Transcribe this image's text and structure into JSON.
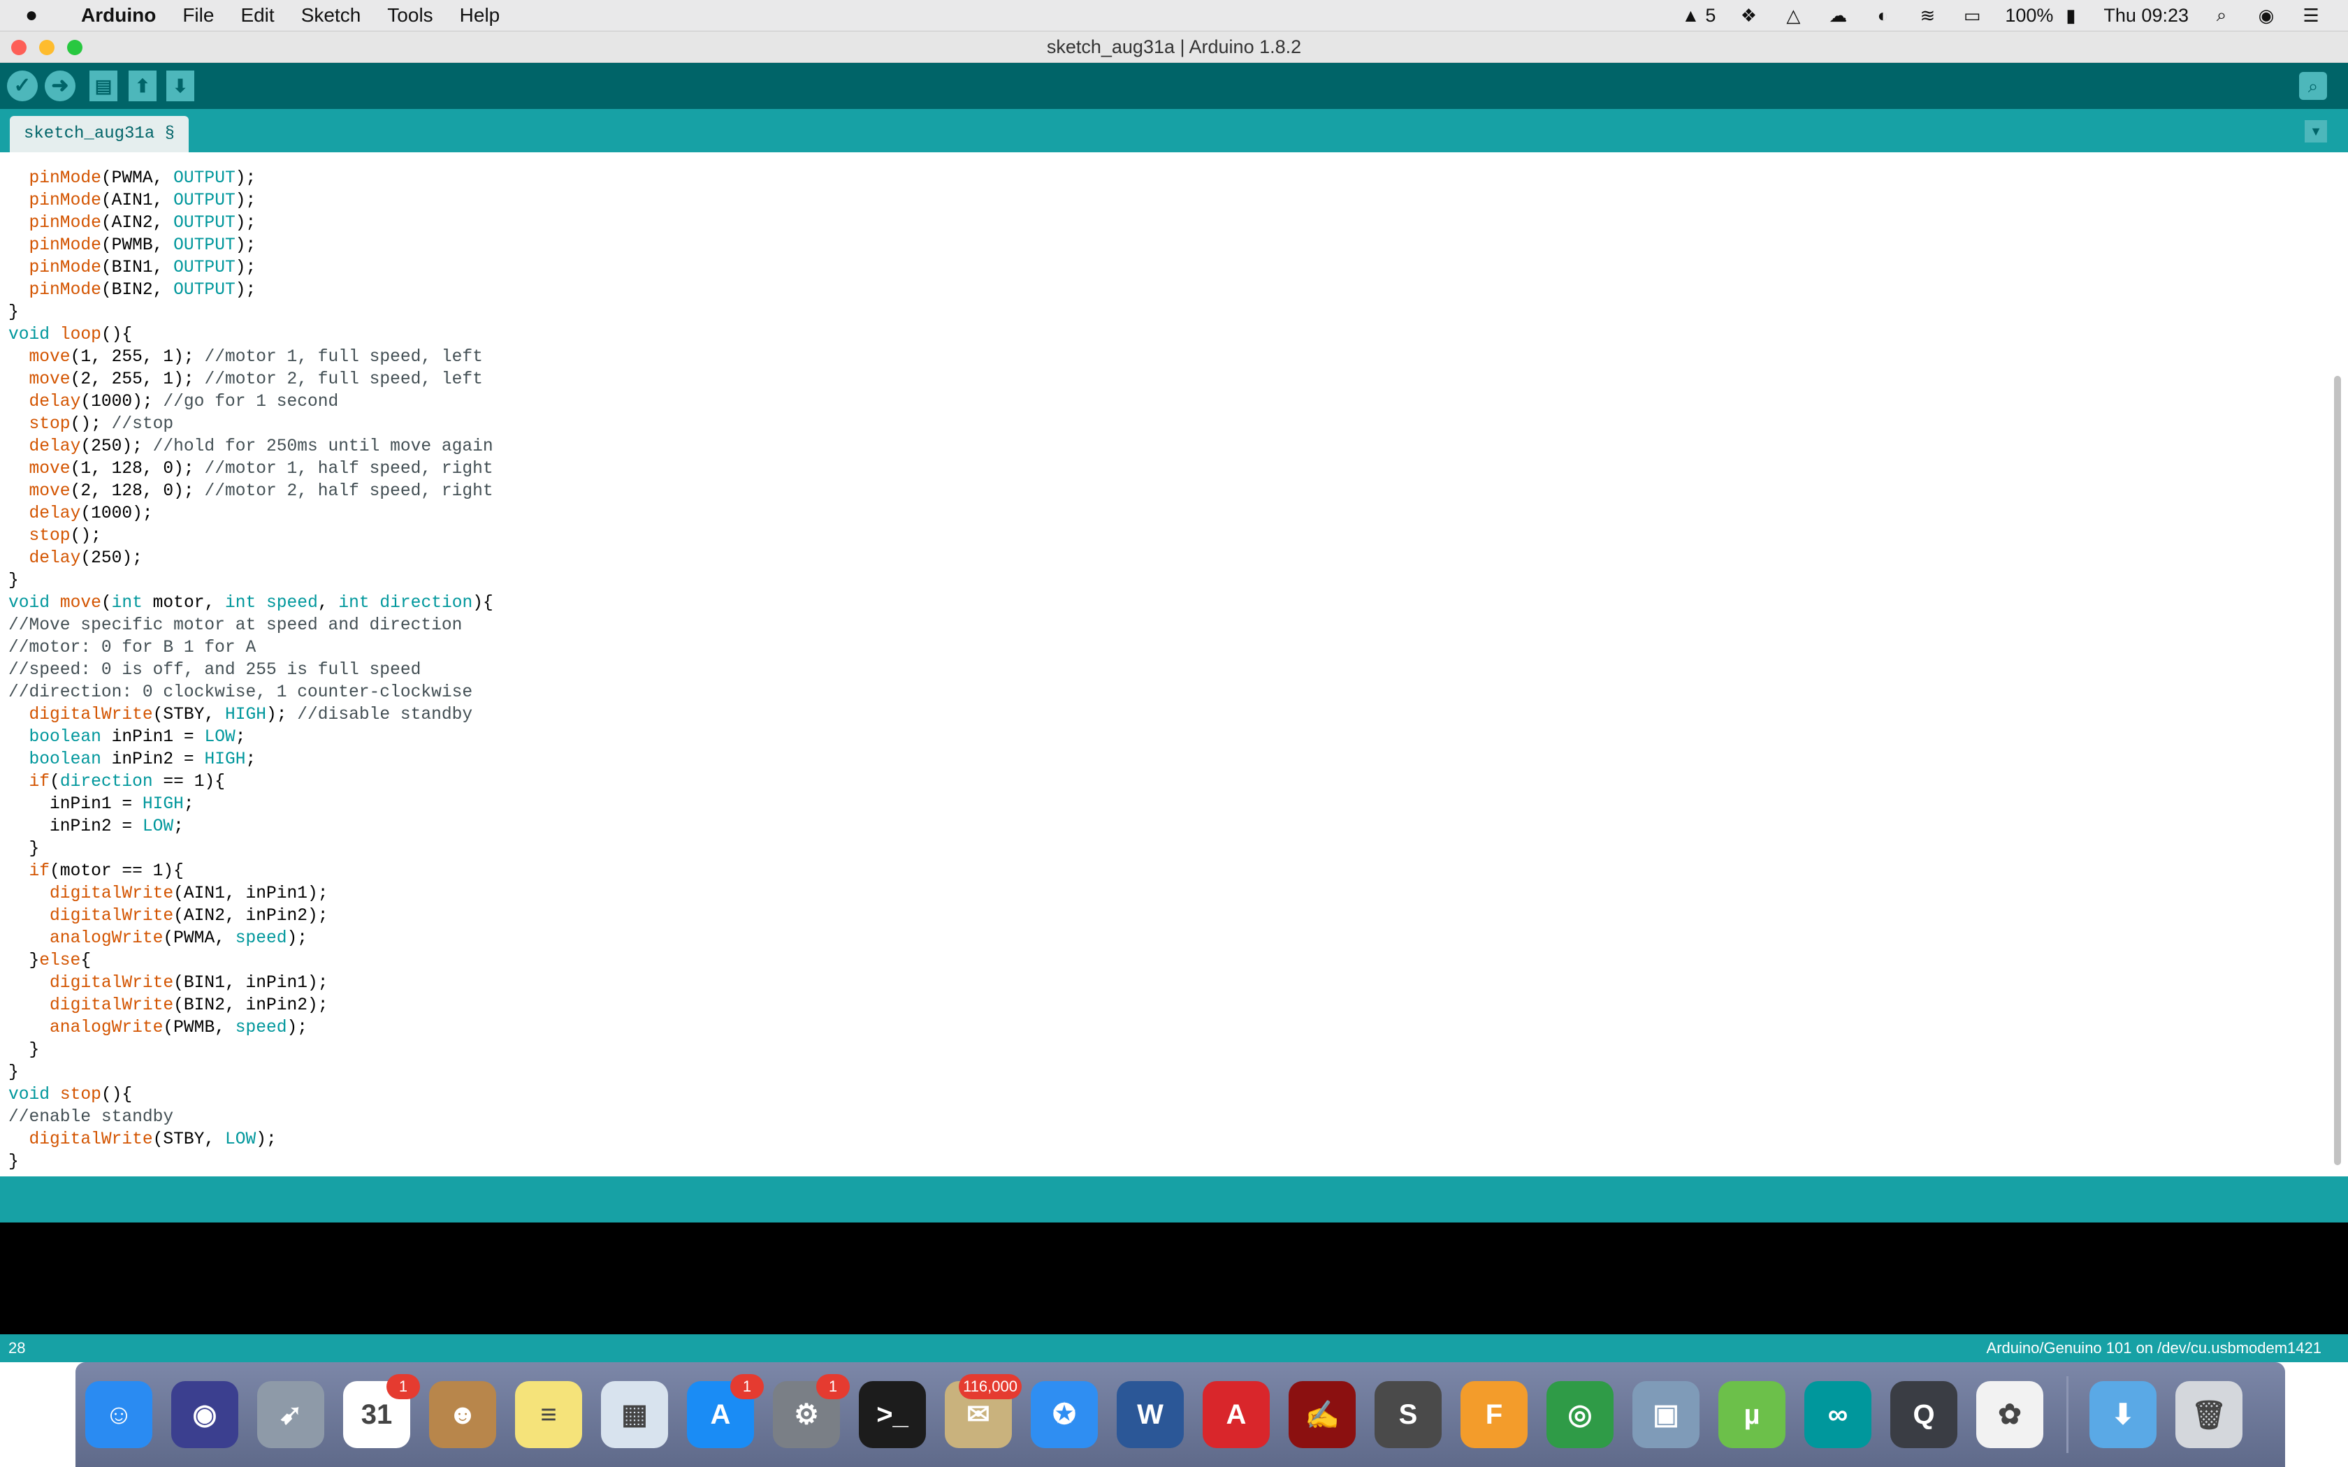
{
  "menubar": {
    "apple": "",
    "items": [
      "Arduino",
      "File",
      "Edit",
      "Sketch",
      "Tools",
      "Help"
    ],
    "status_adobe": "5",
    "battery": "100%",
    "clock": "Thu 09:23"
  },
  "window": {
    "title": "sketch_aug31a | Arduino 1.8.2"
  },
  "toolbar": {
    "verify_icon": "check-icon",
    "upload_icon": "arrow-right-icon",
    "new_icon": "new-file-icon",
    "open_icon": "arrow-up-icon",
    "save_icon": "arrow-down-icon",
    "serial_icon": "magnifier-icon"
  },
  "tabs": {
    "active": "sketch_aug31a §"
  },
  "editor": {
    "lines": [
      "  pinMode(PWMA, OUTPUT);",
      "  pinMode(AIN1, OUTPUT);",
      "  pinMode(AIN2, OUTPUT);",
      "  pinMode(PWMB, OUTPUT);",
      "  pinMode(BIN1, OUTPUT);",
      "  pinMode(BIN2, OUTPUT);",
      "}",
      "void loop(){",
      "  move(1, 255, 1); //motor 1, full speed, left",
      "  move(2, 255, 1); //motor 2, full speed, left",
      "  delay(1000); //go for 1 second",
      "  stop(); //stop",
      "  delay(250); //hold for 250ms until move again",
      "  move(1, 128, 0); //motor 1, half speed, right",
      "  move(2, 128, 0); //motor 2, half speed, right",
      "  delay(1000);",
      "  stop();",
      "  delay(250);",
      "}",
      "void move(int motor, int speed, int direction){",
      "//Move specific motor at speed and direction",
      "//motor: 0 for B 1 for A",
      "//speed: 0 is off, and 255 is full speed",
      "//direction: 0 clockwise, 1 counter-clockwise",
      "  digitalWrite(STBY, HIGH); //disable standby",
      "  boolean inPin1 = LOW;",
      "  boolean inPin2 = HIGH;",
      "  if(direction == 1){",
      "    inPin1 = HIGH;",
      "    inPin2 = LOW;",
      "  }",
      "  if(motor == 1){",
      "    digitalWrite(AIN1, inPin1);",
      "    digitalWrite(AIN2, inPin2);",
      "    analogWrite(PWMA, speed);",
      "  }else{",
      "    digitalWrite(BIN1, inPin1);",
      "    digitalWrite(BIN2, inPin2);",
      "    analogWrite(PWMB, speed);",
      "  }",
      "}",
      "void stop(){",
      "//enable standby",
      "  digitalWrite(STBY, LOW);",
      "}"
    ]
  },
  "footer": {
    "line_number": "28",
    "board": "Arduino/Genuino 101 on /dev/cu.usbmodem1421"
  },
  "dock": {
    "items": [
      {
        "name": "finder-icon",
        "color": "#2a8bf2",
        "glyph": "☺"
      },
      {
        "name": "siri-icon",
        "color": "#3b3f8f",
        "glyph": "◉"
      },
      {
        "name": "launchpad-icon",
        "color": "#8e9aa8",
        "glyph": "➹"
      },
      {
        "name": "calendar-icon",
        "color": "#ffffff",
        "glyph": "31",
        "badge": "1"
      },
      {
        "name": "contacts-icon",
        "color": "#b8864b",
        "glyph": "☻"
      },
      {
        "name": "notes-icon",
        "color": "#f5e37a",
        "glyph": "≡"
      },
      {
        "name": "preview-icon",
        "color": "#d8e3ee",
        "glyph": "▦"
      },
      {
        "name": "app-store-icon",
        "color": "#1a8cf5",
        "glyph": "A",
        "badge": "1"
      },
      {
        "name": "system-preferences-icon",
        "color": "#7a7f86",
        "glyph": "⚙",
        "badge": "1"
      },
      {
        "name": "terminal-icon",
        "color": "#1c1c1c",
        "glyph": ">_"
      },
      {
        "name": "mail-icon",
        "color": "#c9b27d",
        "glyph": "✉",
        "badge": "116,000"
      },
      {
        "name": "safari-icon",
        "color": "#2f8ef2",
        "glyph": "✪"
      },
      {
        "name": "word-icon",
        "color": "#2b5797",
        "glyph": "W"
      },
      {
        "name": "autocad-icon",
        "color": "#d9262b",
        "glyph": "A"
      },
      {
        "name": "acrobat-icon",
        "color": "#8b1010",
        "glyph": "✍"
      },
      {
        "name": "sublime-text-icon",
        "color": "#4a4a4a",
        "glyph": "S"
      },
      {
        "name": "fusion-360-icon",
        "color": "#f39c2b",
        "glyph": "F"
      },
      {
        "name": "chrome-icon",
        "color": "#2f9b47",
        "glyph": "◎"
      },
      {
        "name": "image-capture-icon",
        "color": "#7f9bb8",
        "glyph": "▣"
      },
      {
        "name": "utorrent-icon",
        "color": "#6cc04a",
        "glyph": "µ"
      },
      {
        "name": "arduino-icon",
        "color": "#00979c",
        "glyph": "∞"
      },
      {
        "name": "quicktime-icon",
        "color": "#3a3d44",
        "glyph": "Q"
      },
      {
        "name": "photos-icon",
        "color": "#f2f2f2",
        "glyph": "✿"
      }
    ],
    "downloads": {
      "name": "downloads-folder-icon",
      "color": "#5aa9e6",
      "glyph": "⬇"
    },
    "trash": {
      "name": "trash-icon",
      "color": "#d4d7dc",
      "glyph": "🗑"
    }
  }
}
